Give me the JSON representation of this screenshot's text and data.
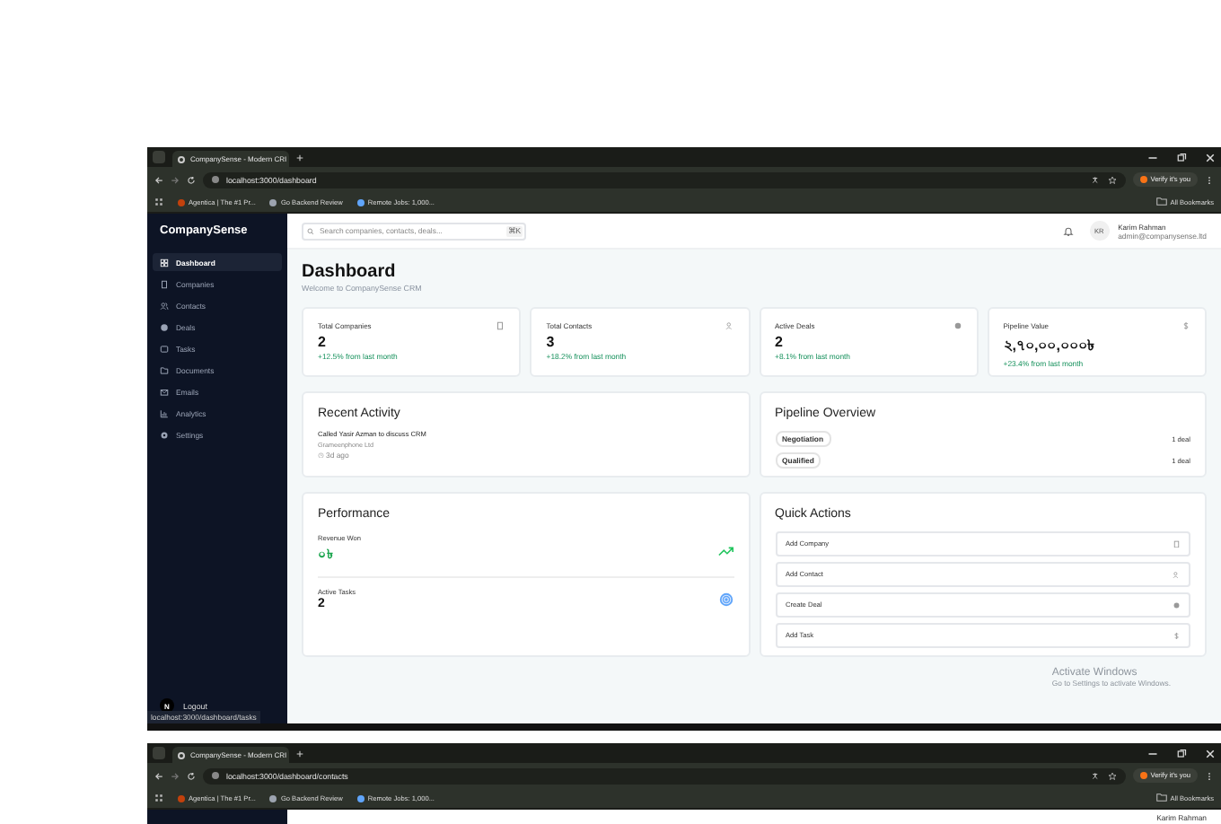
{
  "windows": [
    {
      "tab_title": "CompanySense - Modern CRI",
      "url": "localhost:3000/dashboard",
      "profile": "Verify it's you",
      "bookmarks": [
        "Agentica | The #1 Pr...",
        "Go Backend Review",
        "Remote Jobs: 1,000..."
      ],
      "all_bookmarks": "All Bookmarks",
      "status_url": "localhost:3000/dashboard/tasks"
    },
    {
      "tab_title": "CompanySense - Modern CRI",
      "url": "localhost:3000/dashboard/contacts",
      "profile": "Verify it's you",
      "bookmarks": [
        "Agentica | The #1 Pr...",
        "Go Backend Review",
        "Remote Jobs: 1,000..."
      ],
      "all_bookmarks": "All Bookmarks",
      "user_name": "Karim Rahman"
    }
  ],
  "sidebar": {
    "brand": "CompanySense",
    "items": [
      {
        "label": "Dashboard",
        "selected": true
      },
      {
        "label": "Companies",
        "selected": false
      },
      {
        "label": "Contacts",
        "selected": false
      },
      {
        "label": "Deals",
        "selected": false
      },
      {
        "label": "Tasks",
        "selected": false
      },
      {
        "label": "Documents",
        "selected": false
      },
      {
        "label": "Emails",
        "selected": false
      },
      {
        "label": "Analytics",
        "selected": false
      },
      {
        "label": "Settings",
        "selected": false
      }
    ],
    "avatar": "N",
    "logout": "Logout"
  },
  "topbar": {
    "search_placeholder": "Search companies, contacts, deals...",
    "shortcut": "⌘K",
    "user_initials": "KR",
    "user_name": "Karim Rahman",
    "user_email": "admin@companysense.ltd"
  },
  "page": {
    "title": "Dashboard",
    "subtitle": "Welcome to CompanySense CRM"
  },
  "stats": [
    {
      "label": "Total Companies",
      "value": "2",
      "change": "+12.5% from last month"
    },
    {
      "label": "Total Contacts",
      "value": "3",
      "change": "+18.2% from last month"
    },
    {
      "label": "Active Deals",
      "value": "2",
      "change": "+8.1% from last month"
    },
    {
      "label": "Pipeline Value",
      "value": "২,৭০,০০,০০০৳",
      "change": "+23.4% from last month"
    }
  ],
  "recent_activity": {
    "title": "Recent Activity",
    "items": [
      {
        "text": "Called Yasir Azman to discuss CRM",
        "company": "Grameenphone Ltd",
        "time": "3d ago"
      }
    ]
  },
  "pipeline": {
    "title": "Pipeline Overview",
    "stages": [
      {
        "stage": "Negotiation",
        "count": "1 deal"
      },
      {
        "stage": "Qualified",
        "count": "1 deal"
      }
    ]
  },
  "performance": {
    "title": "Performance",
    "metrics": [
      {
        "label": "Revenue Won",
        "value": "০৳",
        "kind": "trend"
      },
      {
        "label": "Active Tasks",
        "value": "2",
        "kind": "target"
      }
    ]
  },
  "quick_actions": {
    "title": "Quick Actions",
    "actions": [
      "Add Company",
      "Add Contact",
      "Create Deal",
      "Add Task"
    ]
  },
  "os": {
    "watermark_title": "Activate Windows",
    "watermark_text": "Go to Settings to activate Windows."
  }
}
